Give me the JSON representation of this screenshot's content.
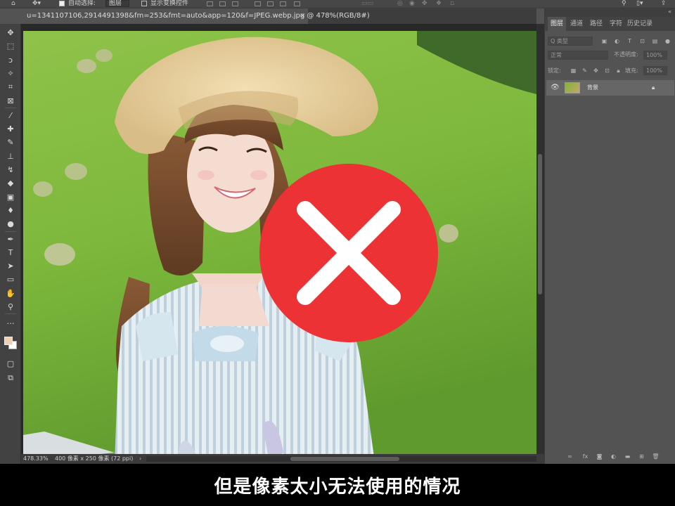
{
  "options_bar": {
    "auto_select_label": "自动选择:",
    "auto_select_target": "图层",
    "show_transform_label": "显示变换控件"
  },
  "document": {
    "tab_title": "u=1341107106,2914491398&fm=253&fmt=auto&app=120&f=JPEG.webp.jpg @ 478%(RGB/8#)",
    "close_glyph": "×"
  },
  "tools": [
    {
      "name": "move-tool",
      "glyph": "✥"
    },
    {
      "name": "marquee-tool",
      "glyph": "⬚"
    },
    {
      "name": "lasso-tool",
      "glyph": "ↄ"
    },
    {
      "name": "magic-wand-tool",
      "glyph": "✧"
    },
    {
      "name": "crop-tool",
      "glyph": "⌗"
    },
    {
      "name": "frame-tool",
      "glyph": "⊠"
    },
    {
      "name": "eyedropper-tool",
      "glyph": "⁄"
    },
    {
      "name": "healing-tool",
      "glyph": "✚"
    },
    {
      "name": "brush-tool",
      "glyph": "✎"
    },
    {
      "name": "stamp-tool",
      "glyph": "⊥"
    },
    {
      "name": "history-brush-tool",
      "glyph": "↯"
    },
    {
      "name": "eraser-tool",
      "glyph": "◆"
    },
    {
      "name": "gradient-tool",
      "glyph": "▣"
    },
    {
      "name": "blur-tool",
      "glyph": "♦"
    },
    {
      "name": "dodge-tool",
      "glyph": "●"
    },
    {
      "name": "pen-tool",
      "glyph": "✒"
    },
    {
      "name": "type-tool",
      "glyph": "T"
    },
    {
      "name": "path-select-tool",
      "glyph": "➤"
    },
    {
      "name": "shape-tool",
      "glyph": "▭"
    },
    {
      "name": "hand-tool",
      "glyph": "✋"
    },
    {
      "name": "zoom-tool",
      "glyph": "⚲"
    },
    {
      "name": "more-tools",
      "glyph": "…"
    }
  ],
  "status": {
    "zoom": "478.33%",
    "doc_info": "400 像素 x 250 像素 (72 ppi)",
    "arrow": "›"
  },
  "panel": {
    "tabs": [
      "图层",
      "通道",
      "路径",
      "字符",
      "历史记录"
    ],
    "active_tab": "图层",
    "kind_placeholder": "Q 类型",
    "blend_mode": "正常",
    "opacity_label": "不透明度:",
    "opacity_value": "100%",
    "lock_label": "锁定:",
    "fill_label": "填充:",
    "fill_value": "100%",
    "layer_name": "背景"
  },
  "overlay": {
    "mark": "✕",
    "color": "#ec3235"
  },
  "subtitle": "但是像素太小无法使用的情况"
}
